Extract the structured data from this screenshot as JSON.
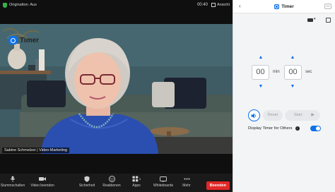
{
  "meeting": {
    "top_bar": {
      "audio_label": "Originalton: Aus",
      "elapsed_time": "00:40",
      "view_label": "Ansicht"
    },
    "participant_name": "Sabine Schmelzer | Video-Marketing",
    "toolbar": {
      "mute_label": "Stummschalten",
      "video_label": "Video beenden",
      "security_label": "Sicherheit",
      "reactions_label": "Reaktionen",
      "apps_label": "Apps",
      "apps_count": "1",
      "whiteboards_label": "Whiteboards",
      "more_label": "Mehr",
      "leave_label": "Beenden"
    }
  },
  "timer_panel": {
    "header_title": "Timer",
    "more_icon": "...",
    "title": "Timer",
    "minutes_value": "00",
    "minutes_unit": "min",
    "seconds_value": "00",
    "seconds_unit": "sec",
    "reset_label": "Reset",
    "start_label": "Start",
    "display_label": "Display Timer for Others",
    "display_toggle_on": true,
    "accent_color": "#0e71eb"
  }
}
